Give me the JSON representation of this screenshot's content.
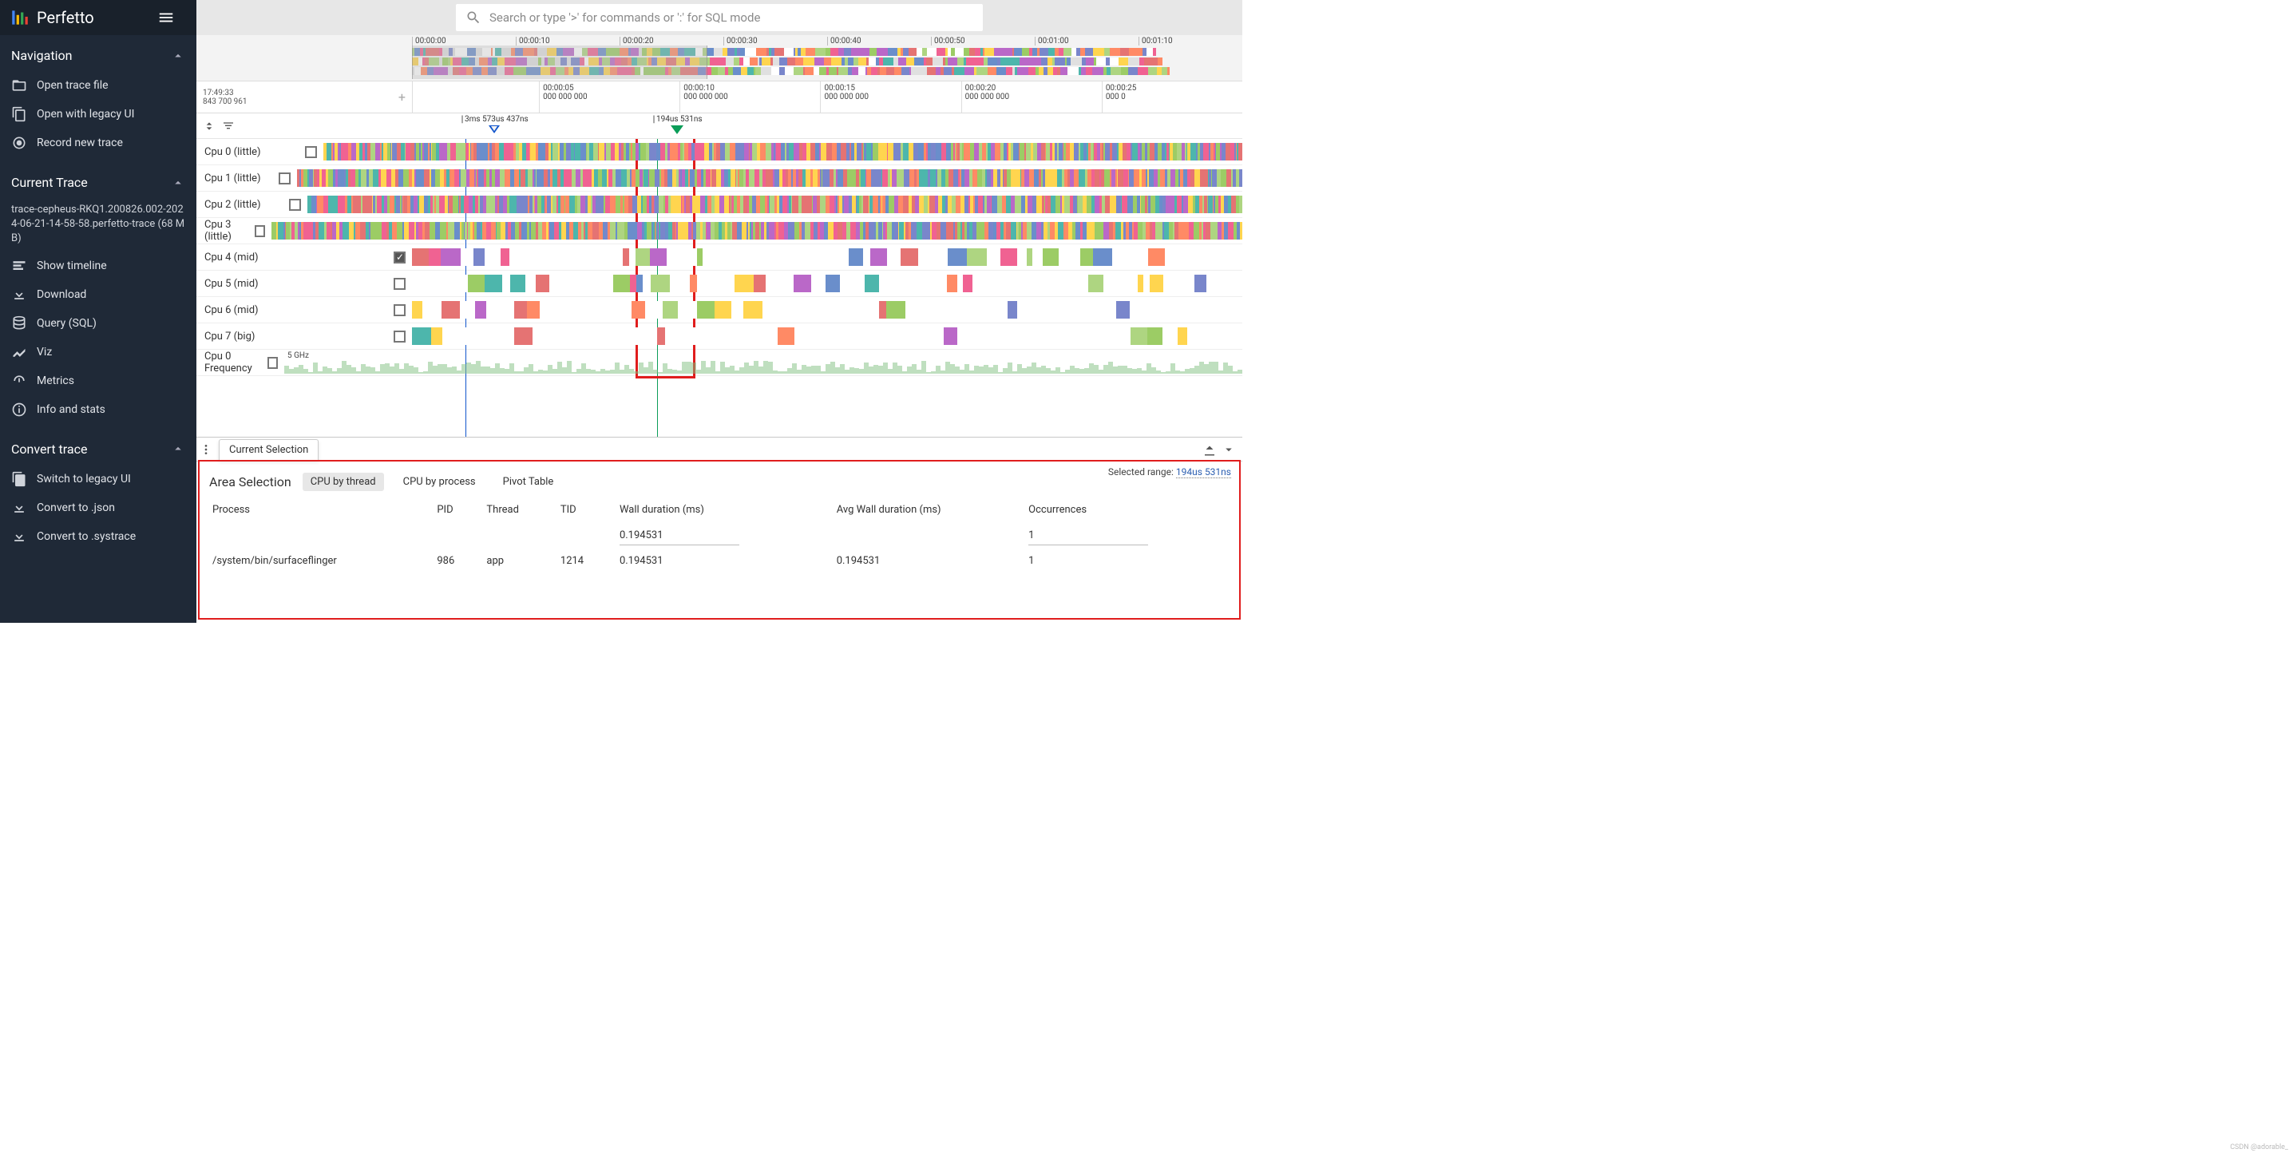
{
  "brand": "Perfetto",
  "search": {
    "placeholder": "Search or type '>' for commands or ':' for SQL mode"
  },
  "sidebar": {
    "nav_title": "Navigation",
    "nav_items": [
      "Open trace file",
      "Open with legacy UI",
      "Record new trace"
    ],
    "trace_title": "Current Trace",
    "trace_file": "trace-cepheus-RKQ1.200826.002-2024-06-21-14-58-58.perfetto-trace (68 MB)",
    "trace_items": [
      "Show timeline",
      "Download",
      "Query (SQL)",
      "Viz",
      "Metrics",
      "Info and stats"
    ],
    "convert_title": "Convert trace",
    "convert_items": [
      "Switch to legacy UI",
      "Convert to .json",
      "Convert to .systrace"
    ]
  },
  "minimap_ticks": [
    "00:00:00",
    "00:00:10",
    "00:00:20",
    "00:00:30",
    "00:00:40",
    "00:00:50",
    "00:01:00",
    "00:01:10"
  ],
  "timeline": {
    "left_time": "17:49:33",
    "left_sub": "843 700 961",
    "ticks": [
      {
        "t": "00:00:05",
        "s": "000 000 000"
      },
      {
        "t": "00:00:10",
        "s": "000 000 000"
      },
      {
        "t": "00:00:15",
        "s": "000 000 000"
      },
      {
        "t": "00:00:20",
        "s": "000 000 000"
      },
      {
        "t": "00:00:25",
        "s": "000 0"
      }
    ]
  },
  "markers": {
    "left": "3ms 573us 437ns",
    "right": "194us 531ns"
  },
  "tracks": [
    {
      "label": "Cpu 0 (little)",
      "checked": false
    },
    {
      "label": "Cpu 1 (little)",
      "checked": false
    },
    {
      "label": "Cpu 2 (little)",
      "checked": false
    },
    {
      "label": "Cpu 3 (little)",
      "checked": false
    },
    {
      "label": "Cpu 4 (mid)",
      "checked": true
    },
    {
      "label": "Cpu 5 (mid)",
      "checked": false
    },
    {
      "label": "Cpu 6 (mid)",
      "checked": false
    },
    {
      "label": "Cpu 7 (big)",
      "checked": false
    },
    {
      "label": "Cpu 0 Frequency",
      "checked": false,
      "freq": "5 GHz"
    }
  ],
  "panel": {
    "tab": "Current Selection",
    "area_title": "Area Selection",
    "sub_tabs": [
      "CPU by thread",
      "CPU by process",
      "Pivot Table"
    ],
    "selected_range_label": "Selected range: ",
    "selected_range_value": "194us 531ns",
    "columns": [
      "Process",
      "PID",
      "Thread",
      "TID",
      "Wall duration (ms)",
      "Avg Wall duration (ms)",
      "Occurrences"
    ],
    "totals": {
      "wall": "0.194531",
      "occ": "1"
    },
    "rows": [
      {
        "process": "/system/bin/surfaceflinger",
        "pid": "986",
        "thread": "app",
        "tid": "1214",
        "wall": "0.194531",
        "avg": "0.194531",
        "occ": "1"
      }
    ]
  },
  "watermark": "CSDN @adorable_"
}
